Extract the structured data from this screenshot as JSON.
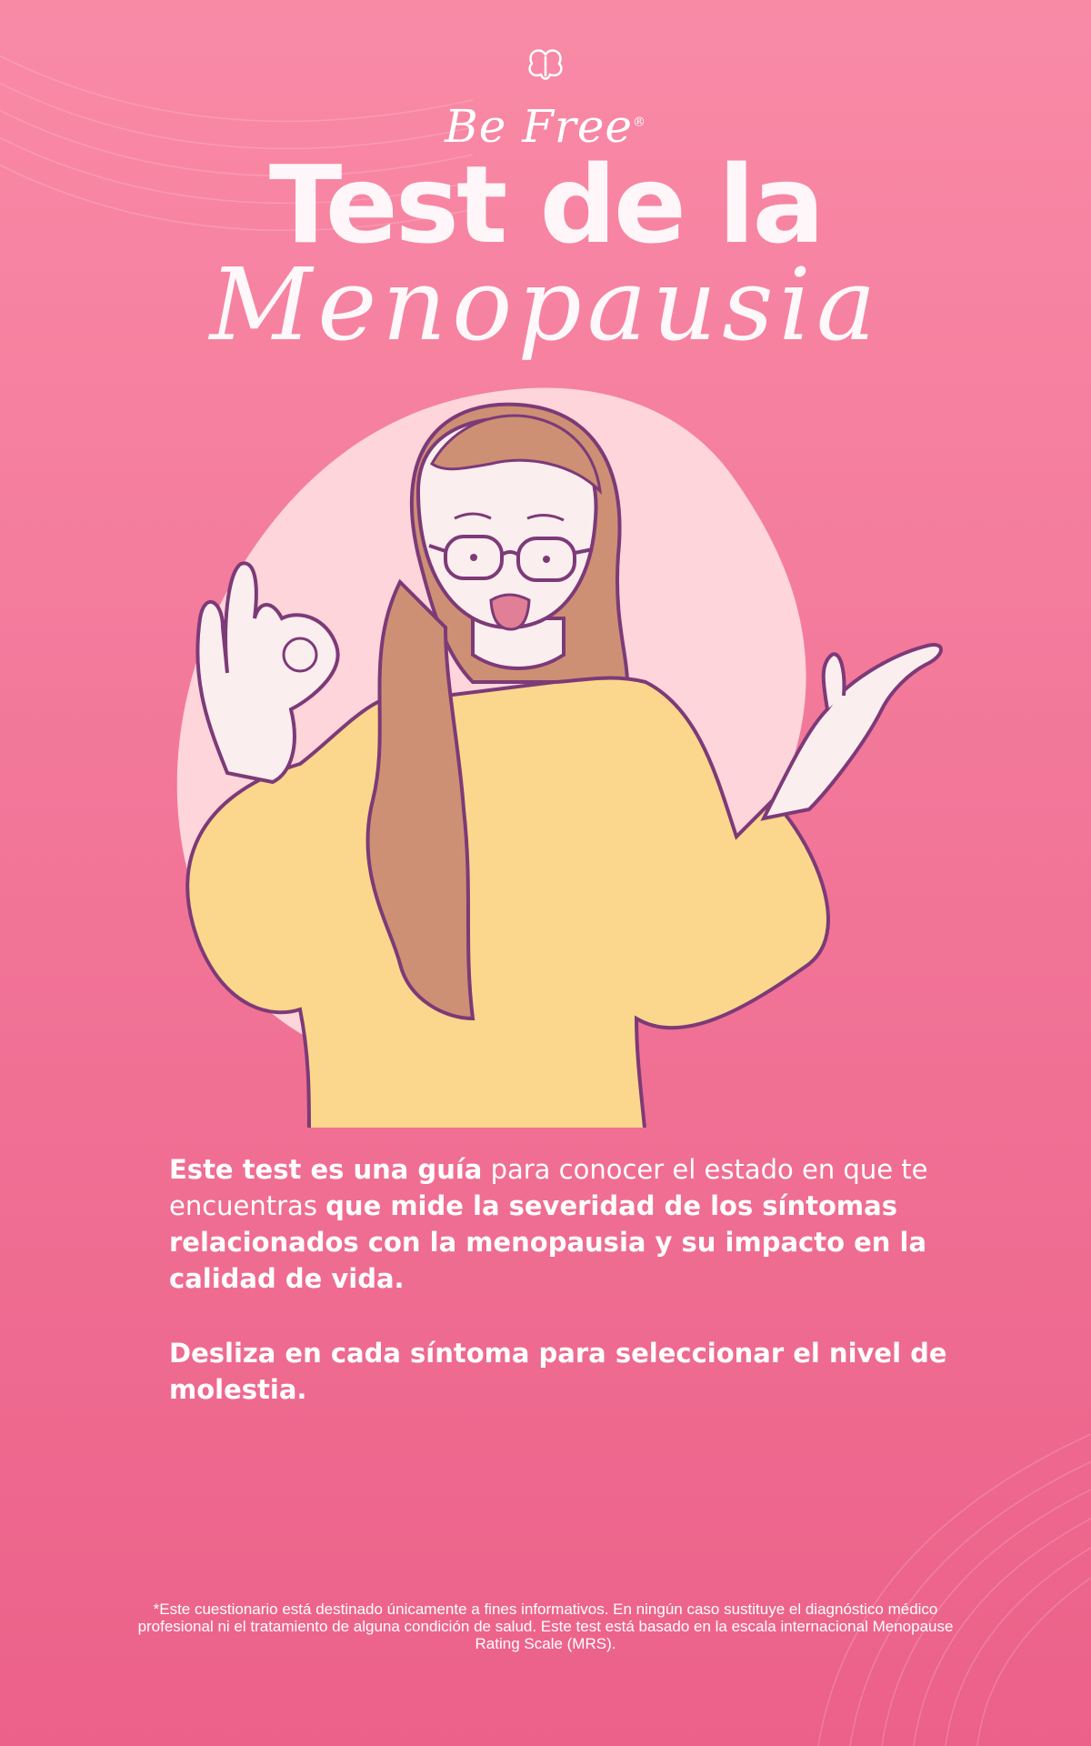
{
  "brand": {
    "name": "Be Free",
    "mark": "®"
  },
  "title": {
    "line1": "Test de la",
    "line2": "Menopausia"
  },
  "intro": {
    "p1_a": "Este test es una guía",
    "p1_b": " para conocer el estado en que te encuentras ",
    "p1_c": "que mide la severidad de los síntomas relacionados con la menopausia y su impacto en la calidad de vida."
  },
  "instruction": "Desliza en cada síntoma para seleccionar el nivel de molestia.",
  "disclaimer": "*Este cuestionario está destinado únicamente a fines informativos. En ningún caso sustituye el diagnóstico médico profesional ni el tratamiento de alguna condición de salud.  Este  test está basado en la escala internacional Menopause Rating Scale (MRS).",
  "colors": {
    "bg_top": "#f98aa6",
    "bg_bottom": "#ec6189",
    "blob": "#fdd5da",
    "sweater": "#fad78c",
    "hair": "#cd9074",
    "outline": "#7d3a78"
  }
}
